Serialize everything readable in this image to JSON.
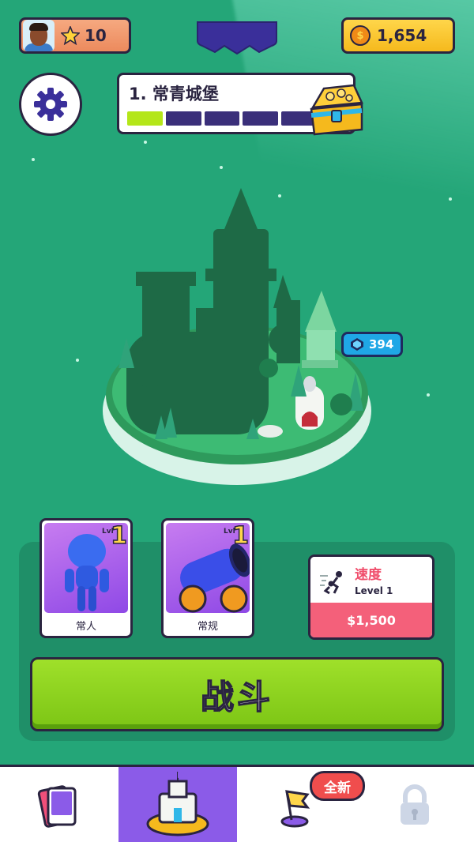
{
  "player": {
    "level": "10",
    "avatar_icon": "player-avatar"
  },
  "currency": {
    "coins": "1,654"
  },
  "stage": {
    "title": "1. 常青城堡",
    "progress_total": 5,
    "progress_filled": 1
  },
  "island": {
    "gem_cost": "394"
  },
  "cards": [
    {
      "label": "常人",
      "level": "1",
      "level_prefix": "Lvl"
    },
    {
      "label": "常规",
      "level": "1",
      "level_prefix": "Lvl"
    }
  ],
  "upgrade": {
    "name": "速度",
    "level": "Level 1",
    "price": "$1,500"
  },
  "fight_button": {
    "label": "战斗"
  },
  "nav": {
    "new_badge": "全新",
    "items": [
      {
        "name": "cards",
        "icon": "cards-icon"
      },
      {
        "name": "home",
        "icon": "castle-icon"
      },
      {
        "name": "events",
        "icon": "flag-icon"
      },
      {
        "name": "locked",
        "icon": "lock-icon"
      }
    ]
  },
  "colors": {
    "background": "#24a678",
    "accent": "#8b5be8",
    "fight": "#8ed41f",
    "coin": "#ffd64a",
    "price": "#f4607a"
  }
}
